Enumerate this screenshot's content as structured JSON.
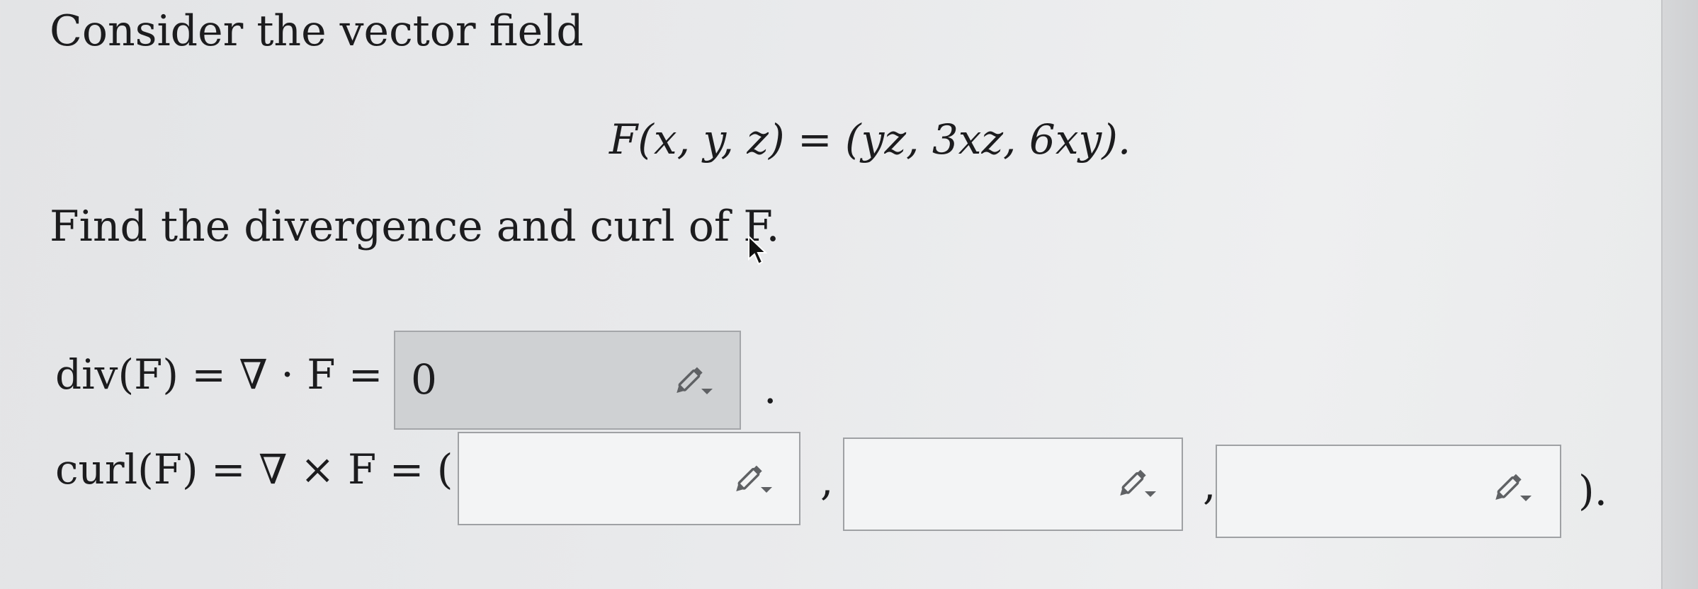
{
  "question": {
    "intro": "Consider the vector field",
    "formula": "F(x, y, z) = (yz, 3xz, 6xy).",
    "prompt": "Find the divergence and curl of F."
  },
  "divergence": {
    "label": "div(F) = ∇ · F =",
    "value": "0",
    "trailing": "."
  },
  "curl": {
    "label": "curl(F) = ∇ × F = (",
    "components": [
      "",
      "",
      ""
    ],
    "separator": ",",
    "closing": ")."
  },
  "icons": {
    "edit": "pencil-dropdown-icon",
    "cursor": "mouse-pointer-icon"
  },
  "colors": {
    "filled_box": "#cfd1d3",
    "empty_box": "#f3f4f5",
    "box_border": "#9fa1a4",
    "text": "#1c1c1e"
  }
}
